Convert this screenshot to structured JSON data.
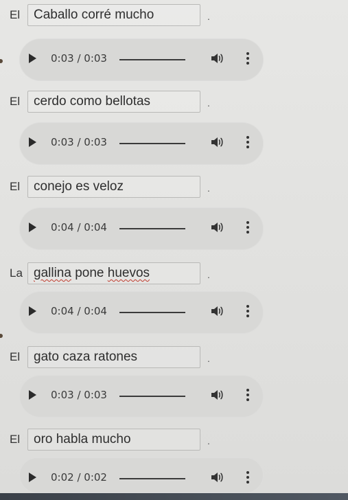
{
  "exercises": [
    {
      "article": "El",
      "answer": "Caballo corré mucho",
      "period": ".",
      "time": "0:03 / 0:03"
    },
    {
      "article": "El",
      "answer": "cerdo como bellotas",
      "period": ".",
      "time": "0:03 / 0:03"
    },
    {
      "article": "El",
      "answer": "conejo es veloz",
      "period": ".",
      "time": "0:04 / 0:04"
    },
    {
      "article": "La",
      "answer_parts": [
        "gallina",
        " pone ",
        "huevos"
      ],
      "period": ".",
      "time": "0:04 / 0:04"
    },
    {
      "article": "El",
      "answer": "gato caza ratones",
      "period": ".",
      "time": "0:03 / 0:03"
    },
    {
      "article": "El",
      "answer": "oro habla mucho",
      "period": ".",
      "time": "0:02 / 0:02"
    }
  ],
  "icons": {
    "play": "play-icon",
    "volume": "volume-icon",
    "menu": "more-vertical-icon"
  }
}
